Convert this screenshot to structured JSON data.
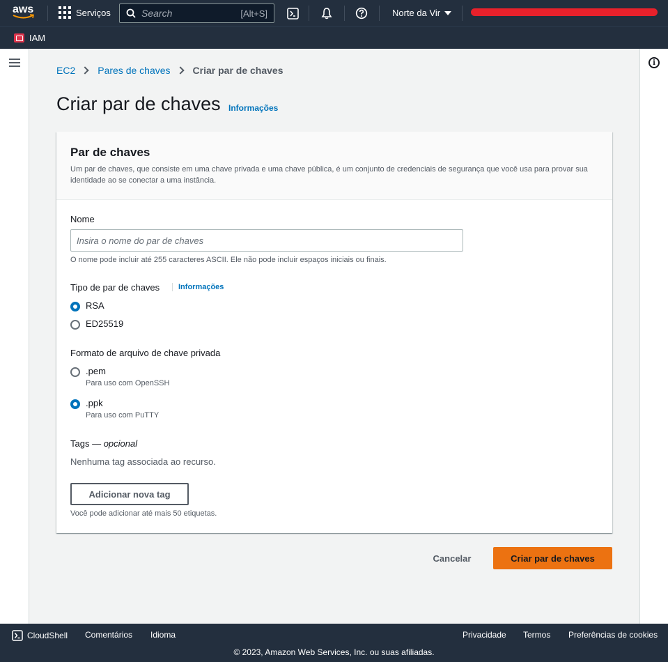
{
  "topnav": {
    "logo_text": "aws",
    "services_label": "Serviços",
    "search_placeholder": "Search",
    "search_shortcut": "[Alt+S]",
    "region_label": "Norte da Vir"
  },
  "subnav": {
    "favorite_label": "IAM"
  },
  "breadcrumb": {
    "items": [
      "EC2",
      "Pares de chaves"
    ],
    "current": "Criar par de chaves"
  },
  "page": {
    "title": "Criar par de chaves",
    "info_link": "Informações"
  },
  "card": {
    "title": "Par de chaves",
    "description": "Um par de chaves, que consiste em uma chave privada e uma chave pública, é um conjunto de credenciais de segurança que você usa para provar sua identidade ao se conectar a uma instância.",
    "name_label": "Nome",
    "name_placeholder": "Insira o nome do par de chaves",
    "name_value": "",
    "name_hint": "O nome pode incluir até 255 caracteres ASCII. Ele não pode incluir espaços iniciais ou finais.",
    "key_type_label": "Tipo de par de chaves",
    "key_type_info": "Informações",
    "key_types": [
      {
        "label": "RSA",
        "checked": true
      },
      {
        "label": "ED25519",
        "checked": false
      }
    ],
    "format_label": "Formato de arquivo de chave privada",
    "formats": [
      {
        "label": ".pem",
        "sub": "Para uso com OpenSSH",
        "checked": false
      },
      {
        "label": ".ppk",
        "sub": "Para uso com PuTTY",
        "checked": true
      }
    ],
    "tags_label": "Tags —",
    "tags_optional": "opcional",
    "no_tags": "Nenhuma tag associada ao recurso.",
    "add_tag_button": "Adicionar nova tag",
    "tag_hint": "Você pode adicionar até mais 50 etiquetas."
  },
  "actions": {
    "cancel": "Cancelar",
    "submit": "Criar par de chaves"
  },
  "footer": {
    "cloudshell": "CloudShell",
    "feedback": "Comentários",
    "language": "Idioma",
    "privacy": "Privacidade",
    "terms": "Termos",
    "cookies": "Preferências de cookies",
    "copyright": "© 2023, Amazon Web Services, Inc. ou suas afiliadas."
  },
  "colors": {
    "nav_bg": "#232f3e",
    "link": "#0073bb",
    "primary": "#ec7211",
    "account_redaction": "#e8212b"
  }
}
